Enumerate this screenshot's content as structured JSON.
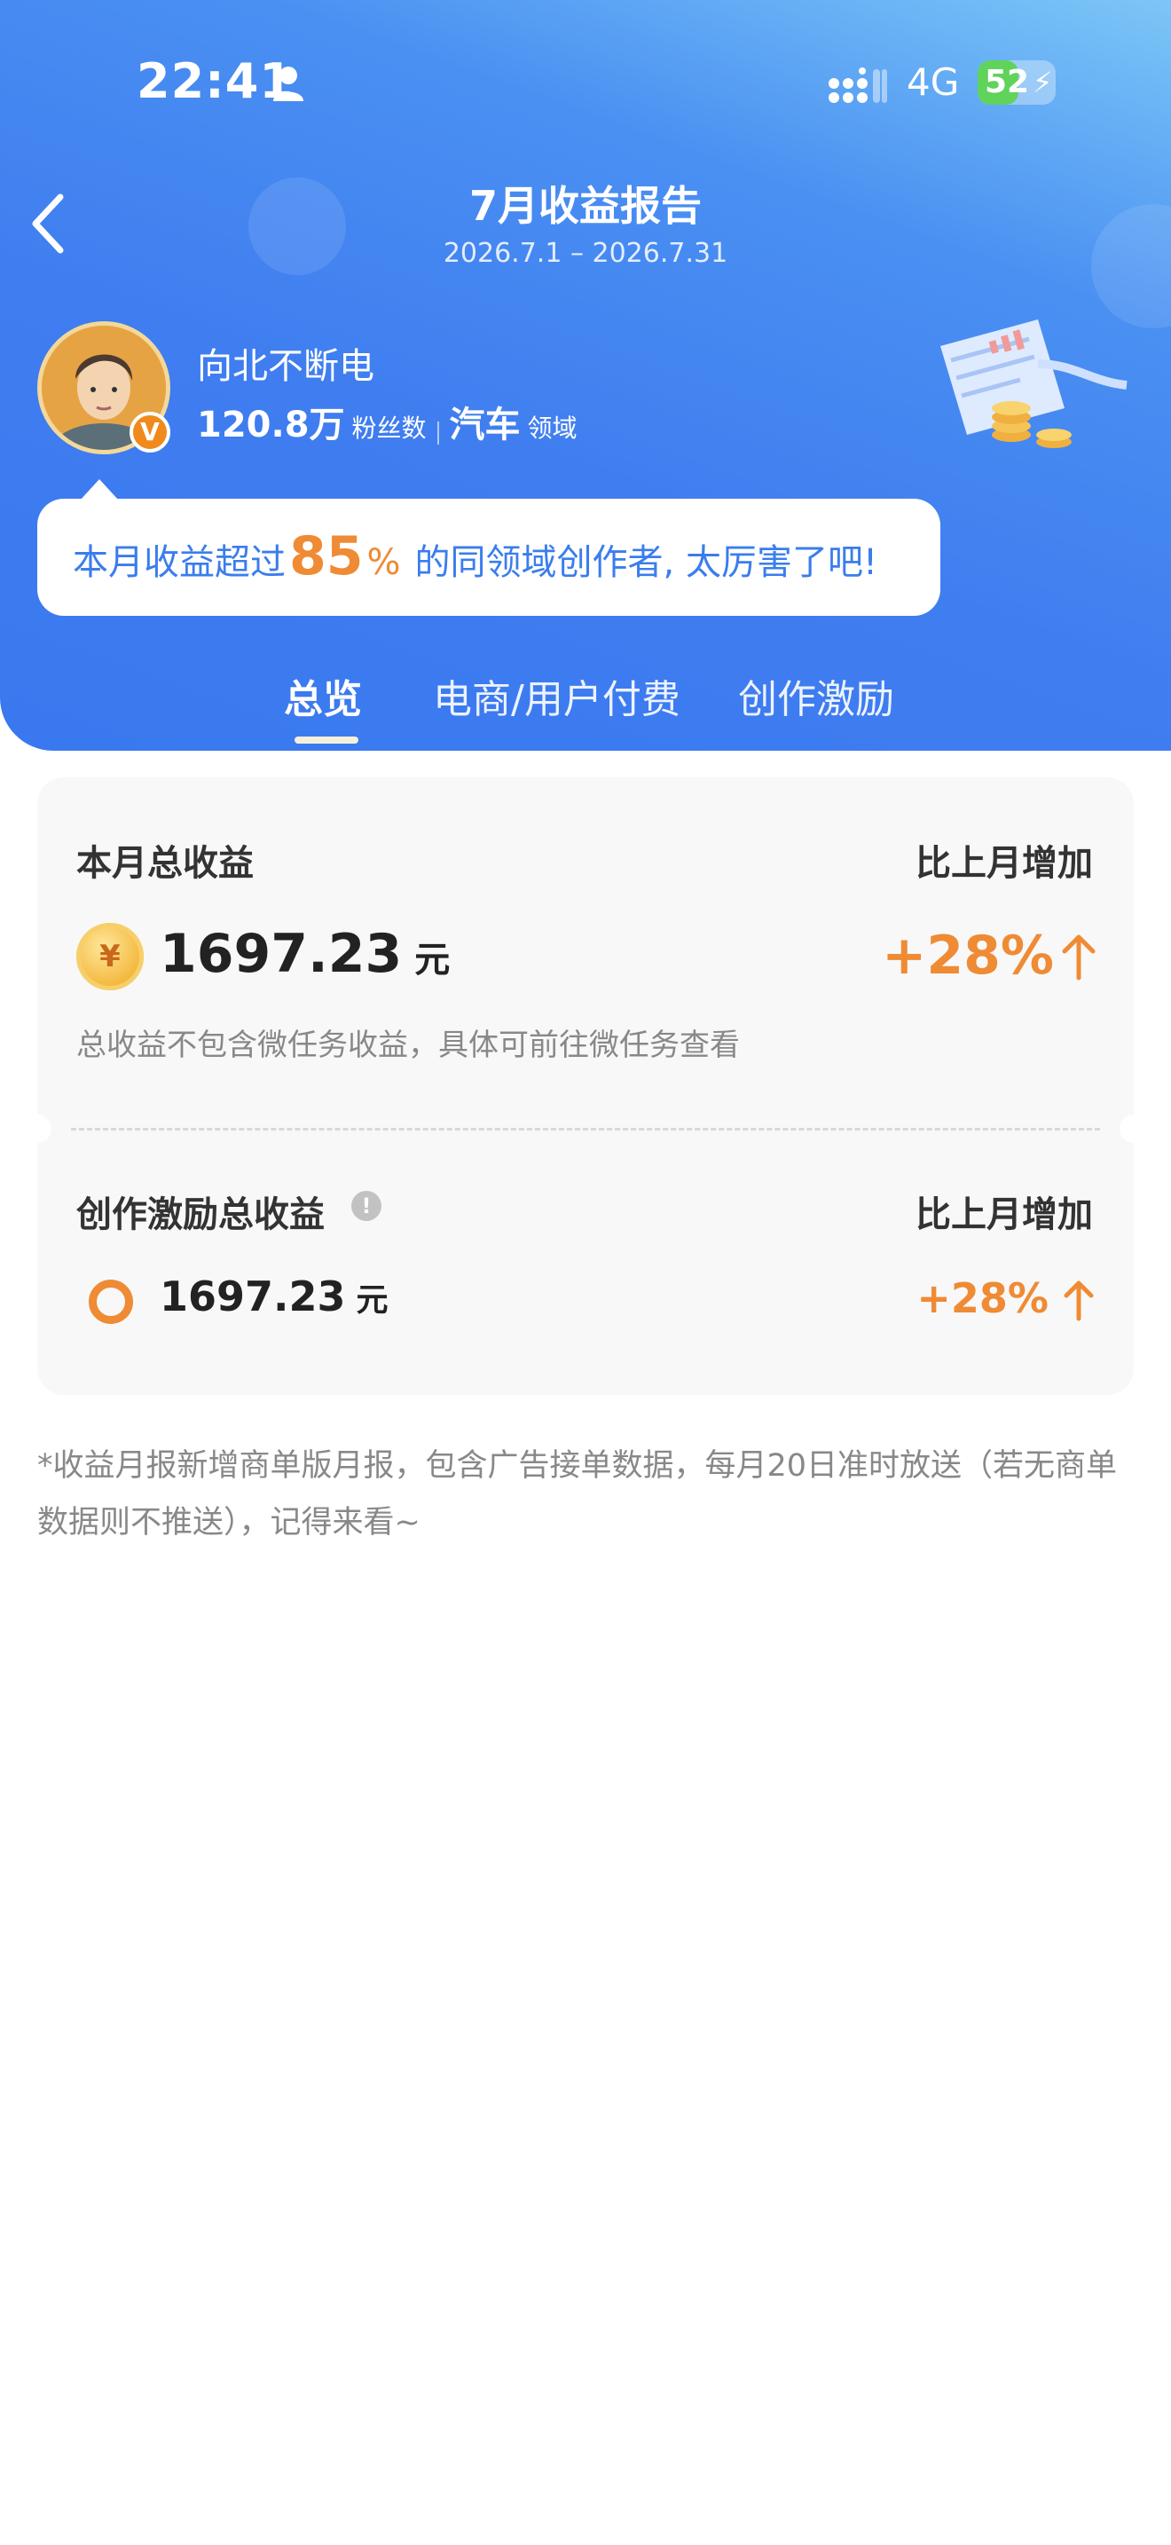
{
  "status_bar": {
    "time": "22:41",
    "network": "4G",
    "battery_percent": "52",
    "battery_level": 0.52,
    "icons": [
      "person-icon",
      "signal-icon",
      "charging-bolt-icon"
    ]
  },
  "header": {
    "back_icon": "chevron-left-icon",
    "title": "7月收益报告",
    "date_range": "2026.7.1 – 2026.7.31"
  },
  "profile": {
    "name": "向北不断电",
    "followers_value": "120.8万",
    "followers_label": "粉丝数",
    "field_value": "汽车",
    "field_label": "领域",
    "badge": "V"
  },
  "bubble": {
    "prefix": "本月收益超过",
    "percent": "85",
    "percent_sign": "%",
    "suffix": "的同领域创作者, 太厉害了吧!"
  },
  "tabs": [
    {
      "label": "总览",
      "active": true
    },
    {
      "label": "电商/用户付费",
      "active": false
    },
    {
      "label": "创作激励",
      "active": false
    }
  ],
  "summary": {
    "total_label": "本月总收益",
    "compare_label": "比上月增加",
    "coin_symbol": "¥",
    "total_amount": "1697.23",
    "unit": "元",
    "growth": "+28%",
    "note": "总收益不包含微任务收益，具体可前往微任务查看"
  },
  "incentive": {
    "label": "创作激励总收益",
    "info_symbol": "!",
    "compare_label": "比上月增加",
    "amount": "1697.23",
    "unit": "元",
    "growth": "+28%"
  },
  "footnote": "*收益月报新增商单版月报，包含广告接单数据，每月20日准时放送（若无商单数据则不推送），记得来看~",
  "colors": {
    "accent_blue": "#3f7df0",
    "accent_orange": "#ef8b34",
    "card_bg": "#f8f8f8"
  }
}
